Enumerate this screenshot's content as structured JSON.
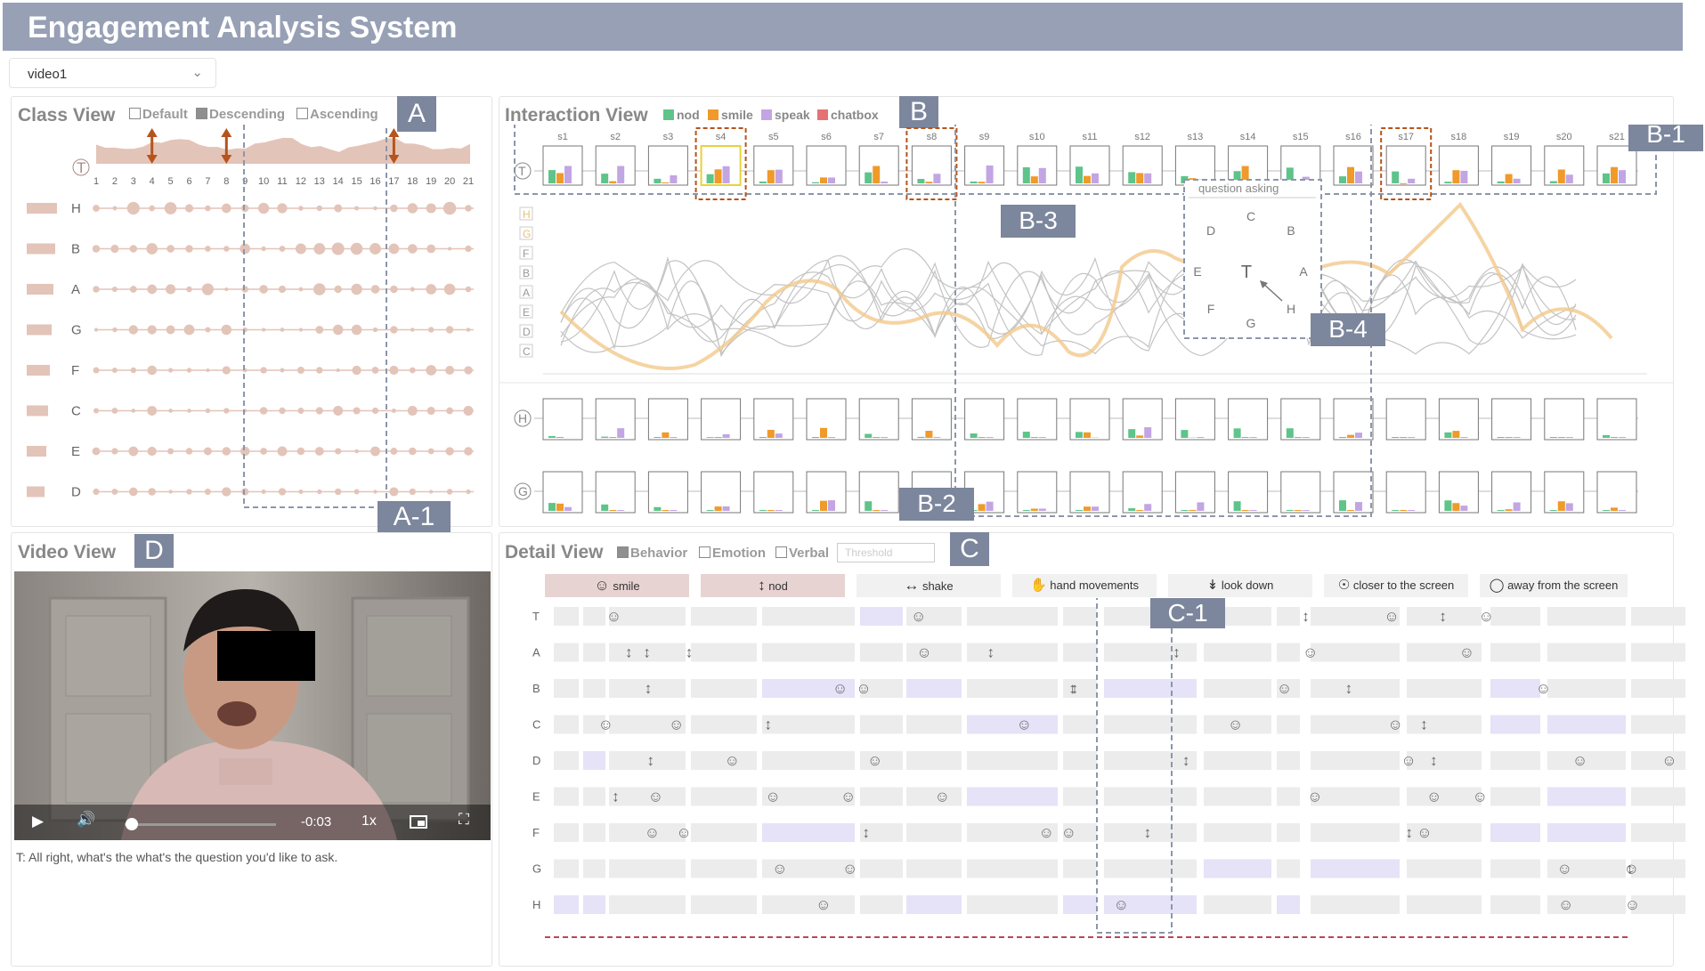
{
  "header": {
    "title": "Engagement Analysis System"
  },
  "video_select": {
    "value": "video1"
  },
  "class_view": {
    "title": "Class View",
    "options": [
      {
        "label": "Default",
        "checked": false
      },
      {
        "label": "Descending",
        "checked": true
      },
      {
        "label": "Ascending",
        "checked": false
      }
    ],
    "teacher_label": "T",
    "sessions": [
      "1",
      "2",
      "3",
      "4",
      "5",
      "6",
      "7",
      "8",
      "9",
      "10",
      "11",
      "12",
      "13",
      "14",
      "15",
      "16",
      "17",
      "18",
      "19",
      "20",
      "21"
    ],
    "students": [
      "H",
      "B",
      "A",
      "G",
      "F",
      "C",
      "E",
      "D"
    ]
  },
  "interaction_view": {
    "title": "Interaction View",
    "legend": [
      {
        "label": "nod",
        "color": "#5ec48a"
      },
      {
        "label": "smile",
        "color": "#ef9a2a"
      },
      {
        "label": "speak",
        "color": "#c2a5e3"
      },
      {
        "label": "chatbox",
        "color": "#e57272"
      }
    ],
    "teacher_label": "T",
    "sessions": [
      "s1",
      "s2",
      "s3",
      "s4",
      "s5",
      "s6",
      "s7",
      "s8",
      "s9",
      "s10",
      "s11",
      "s12",
      "s13",
      "s14",
      "s15",
      "s16",
      "s17",
      "s18",
      "s19",
      "s20",
      "s21"
    ],
    "student_axis": [
      "H",
      "G",
      "F",
      "B",
      "A",
      "E",
      "D",
      "C"
    ],
    "row_labels": [
      "H",
      "G"
    ],
    "popup": {
      "title": "question asking",
      "center": "T",
      "nodes": [
        "C",
        "B",
        "A",
        "H",
        "G",
        "F",
        "E",
        "D"
      ]
    }
  },
  "video_view": {
    "title": "Video View",
    "time": "-0:03",
    "speed": "1x",
    "transcript": "T: All right, what's the what's the question you'd like to ask."
  },
  "detail_view": {
    "title": "Detail View",
    "options": [
      {
        "label": "Behavior",
        "checked": true
      },
      {
        "label": "Emotion",
        "checked": false
      },
      {
        "label": "Verbal",
        "checked": false
      }
    ],
    "threshold_placeholder": "Threshold",
    "behaviors": [
      {
        "label": "smile",
        "icon": "smile-icon",
        "active": true
      },
      {
        "label": "nod",
        "icon": "nod-icon",
        "active": true
      },
      {
        "label": "shake",
        "icon": "shake-icon",
        "active": false
      },
      {
        "label": "hand movements",
        "icon": "hand-icon",
        "active": false
      },
      {
        "label": "look down",
        "icon": "look-down-icon",
        "active": false
      },
      {
        "label": "closer to the screen",
        "icon": "closer-icon",
        "active": false
      },
      {
        "label": "away from the screen",
        "icon": "away-icon",
        "active": false
      }
    ],
    "rows": [
      "T",
      "A",
      "B",
      "C",
      "D",
      "E",
      "F",
      "G",
      "H"
    ]
  },
  "annotations": {
    "A": "A",
    "A1": "A-1",
    "B": "B",
    "B1": "B-1",
    "B2": "B-2",
    "B3": "B-3",
    "B4": "B-4",
    "C": "C",
    "C1": "C-1",
    "D": "D"
  },
  "colors": {
    "header": "#97a0b5",
    "tag": "#7c869d",
    "class_mark": "#e3c4b8",
    "arrow": "#b5541c",
    "highlight": "#f2c98c"
  }
}
